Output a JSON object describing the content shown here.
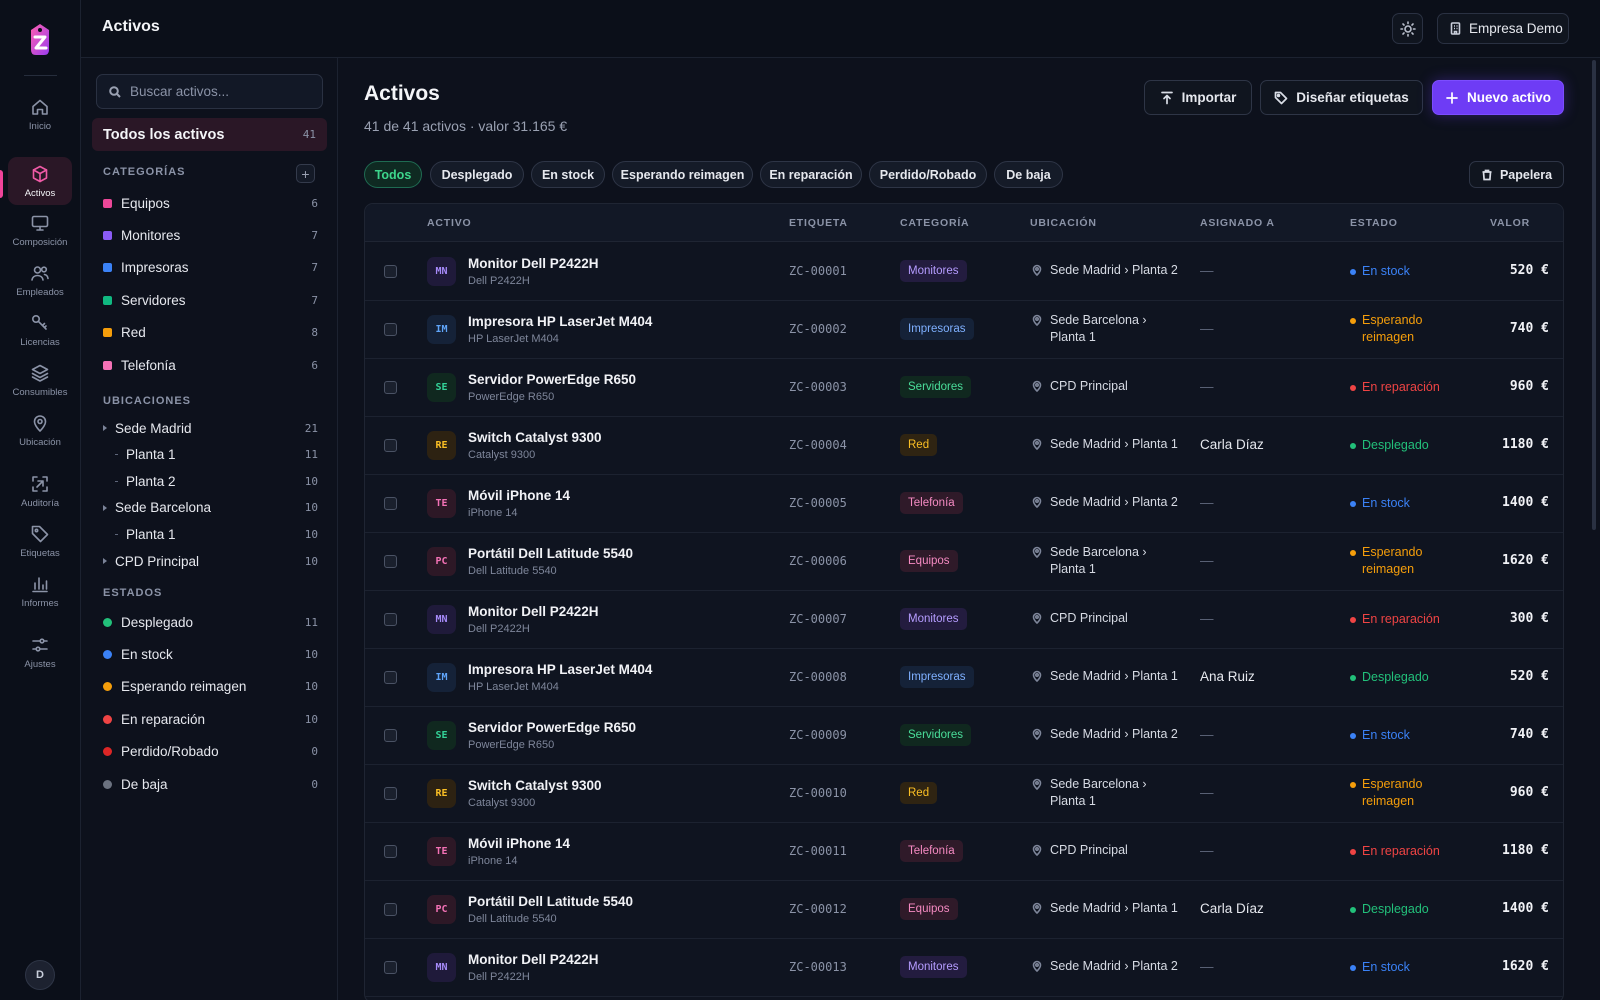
{
  "colors": {
    "accent": "#f0449a",
    "primary": "#6e3cf5",
    "deployed": "#22c07a",
    "in_stock": "#3b82f6",
    "awaiting": "#f59e0b",
    "repair": "#ef4444"
  },
  "nav": [
    {
      "label": "Inicio",
      "icon": "home-icon"
    },
    {
      "label": "Activos",
      "icon": "box-icon",
      "active": true
    },
    {
      "label": "Composición",
      "icon": "monitor-icon"
    },
    {
      "label": "Empleados",
      "icon": "users-icon"
    },
    {
      "label": "Licencias",
      "icon": "key-icon"
    },
    {
      "label": "Consumibles",
      "icon": "layers-icon"
    },
    {
      "label": "Ubicación",
      "icon": "map-pin-icon"
    },
    {
      "label": "Auditoría",
      "icon": "scan-icon"
    },
    {
      "label": "Etiquetas",
      "icon": "tag-icon"
    },
    {
      "label": "Informes",
      "icon": "bar-chart-icon"
    },
    {
      "label": "Ajustes",
      "icon": "sliders-icon"
    }
  ],
  "user": {
    "initial": "D"
  },
  "topbar": {
    "title": "Activos",
    "company": "Empresa Demo"
  },
  "sidebar": {
    "search_placeholder": "Buscar activos...",
    "all": {
      "label": "Todos los activos",
      "count": "41"
    },
    "categories_title": "CATEGORÍAS",
    "categories": [
      {
        "label": "Equipos",
        "count": "6",
        "color": "#ec4899"
      },
      {
        "label": "Monitores",
        "count": "7",
        "color": "#8b5cf6"
      },
      {
        "label": "Impresoras",
        "count": "7",
        "color": "#3b82f6"
      },
      {
        "label": "Servidores",
        "count": "7",
        "color": "#10b981"
      },
      {
        "label": "Red",
        "count": "8",
        "color": "#f59e0b"
      },
      {
        "label": "Telefonía",
        "count": "6",
        "color": "#f472b6"
      }
    ],
    "locations_title": "UBICACIONES",
    "locations": [
      {
        "label": "Sede Madrid",
        "count": "21",
        "level": 0
      },
      {
        "label": "Planta 1",
        "count": "11",
        "level": 1
      },
      {
        "label": "Planta 2",
        "count": "10",
        "level": 1
      },
      {
        "label": "Sede Barcelona",
        "count": "10",
        "level": 0
      },
      {
        "label": "Planta 1",
        "count": "10",
        "level": 1
      },
      {
        "label": "CPD Principal",
        "count": "10",
        "level": 0
      }
    ],
    "states_title": "ESTADOS",
    "states": [
      {
        "label": "Desplegado",
        "count": "11",
        "color": "#22c07a"
      },
      {
        "label": "En stock",
        "count": "10",
        "color": "#3b82f6"
      },
      {
        "label": "Esperando reimagen",
        "count": "10",
        "color": "#f59e0b"
      },
      {
        "label": "En reparación",
        "count": "10",
        "color": "#ef4444"
      },
      {
        "label": "Perdido/Robado",
        "count": "0",
        "color": "#dc2626"
      },
      {
        "label": "De baja",
        "count": "0",
        "color": "#6b7280"
      }
    ]
  },
  "main": {
    "title": "Activos",
    "subtitle": "41 de 41 activos · valor 31.165 €",
    "import_label": "Importar",
    "labels_label": "Diseñar etiquetas",
    "new_label": "Nuevo activo",
    "trash_label": "Papelera",
    "filters": [
      "Todos",
      "Desplegado",
      "En stock",
      "Esperando reimagen",
      "En reparación",
      "Perdido/Robado",
      "De baja"
    ]
  },
  "table": {
    "columns": [
      "ACTIVO",
      "ETIQUETA",
      "CATEGORÍA",
      "UBICACIÓN",
      "ASIGNADO A",
      "ESTADO",
      "VALOR"
    ],
    "rows": [
      {
        "abbr": "MN",
        "name": "Monitor Dell P2422H",
        "model": "Dell P2422H",
        "tag": "ZC-00001",
        "category": "Monitores",
        "location": "Sede Madrid › Planta 2",
        "assigned": "—",
        "status": "En stock",
        "value": "520 €"
      },
      {
        "abbr": "IM",
        "name": "Impresora HP LaserJet M404",
        "model": "HP LaserJet M404",
        "tag": "ZC-00002",
        "category": "Impresoras",
        "location": "Sede Barcelona › Planta 1",
        "assigned": "—",
        "status": "Esperando reimagen",
        "value": "740 €"
      },
      {
        "abbr": "SE",
        "name": "Servidor PowerEdge R650",
        "model": "PowerEdge R650",
        "tag": "ZC-00003",
        "category": "Servidores",
        "location": "CPD Principal",
        "assigned": "—",
        "status": "En reparación",
        "value": "960 €"
      },
      {
        "abbr": "RE",
        "name": "Switch Catalyst 9300",
        "model": "Catalyst 9300",
        "tag": "ZC-00004",
        "category": "Red",
        "location": "Sede Madrid › Planta 1",
        "assigned": "Carla Díaz",
        "status": "Desplegado",
        "value": "1180 €"
      },
      {
        "abbr": "TE",
        "name": "Móvil iPhone 14",
        "model": "iPhone 14",
        "tag": "ZC-00005",
        "category": "Telefonía",
        "location": "Sede Madrid › Planta 2",
        "assigned": "—",
        "status": "En stock",
        "value": "1400 €"
      },
      {
        "abbr": "PC",
        "name": "Portátil Dell Latitude 5540",
        "model": "Dell Latitude 5540",
        "tag": "ZC-00006",
        "category": "Equipos",
        "location": "Sede Barcelona › Planta 1",
        "assigned": "—",
        "status": "Esperando reimagen",
        "value": "1620 €"
      },
      {
        "abbr": "MN",
        "name": "Monitor Dell P2422H",
        "model": "Dell P2422H",
        "tag": "ZC-00007",
        "category": "Monitores",
        "location": "CPD Principal",
        "assigned": "—",
        "status": "En reparación",
        "value": "300 €"
      },
      {
        "abbr": "IM",
        "name": "Impresora HP LaserJet M404",
        "model": "HP LaserJet M404",
        "tag": "ZC-00008",
        "category": "Impresoras",
        "location": "Sede Madrid › Planta 1",
        "assigned": "Ana Ruiz",
        "status": "Desplegado",
        "value": "520 €"
      },
      {
        "abbr": "SE",
        "name": "Servidor PowerEdge R650",
        "model": "PowerEdge R650",
        "tag": "ZC-00009",
        "category": "Servidores",
        "location": "Sede Madrid › Planta 2",
        "assigned": "—",
        "status": "En stock",
        "value": "740 €"
      },
      {
        "abbr": "RE",
        "name": "Switch Catalyst 9300",
        "model": "Catalyst 9300",
        "tag": "ZC-00010",
        "category": "Red",
        "location": "Sede Barcelona › Planta 1",
        "assigned": "—",
        "status": "Esperando reimagen",
        "value": "960 €"
      },
      {
        "abbr": "TE",
        "name": "Móvil iPhone 14",
        "model": "iPhone 14",
        "tag": "ZC-00011",
        "category": "Telefonía",
        "location": "CPD Principal",
        "assigned": "—",
        "status": "En reparación",
        "value": "1180 €"
      },
      {
        "abbr": "PC",
        "name": "Portátil Dell Latitude 5540",
        "model": "Dell Latitude 5540",
        "tag": "ZC-00012",
        "category": "Equipos",
        "location": "Sede Madrid › Planta 1",
        "assigned": "Carla Díaz",
        "status": "Desplegado",
        "value": "1400 €"
      },
      {
        "abbr": "MN",
        "name": "Monitor Dell P2422H",
        "model": "Dell P2422H",
        "tag": "ZC-00013",
        "category": "Monitores",
        "location": "Sede Madrid › Planta 2",
        "assigned": "—",
        "status": "En stock",
        "value": "1620 €"
      }
    ]
  }
}
